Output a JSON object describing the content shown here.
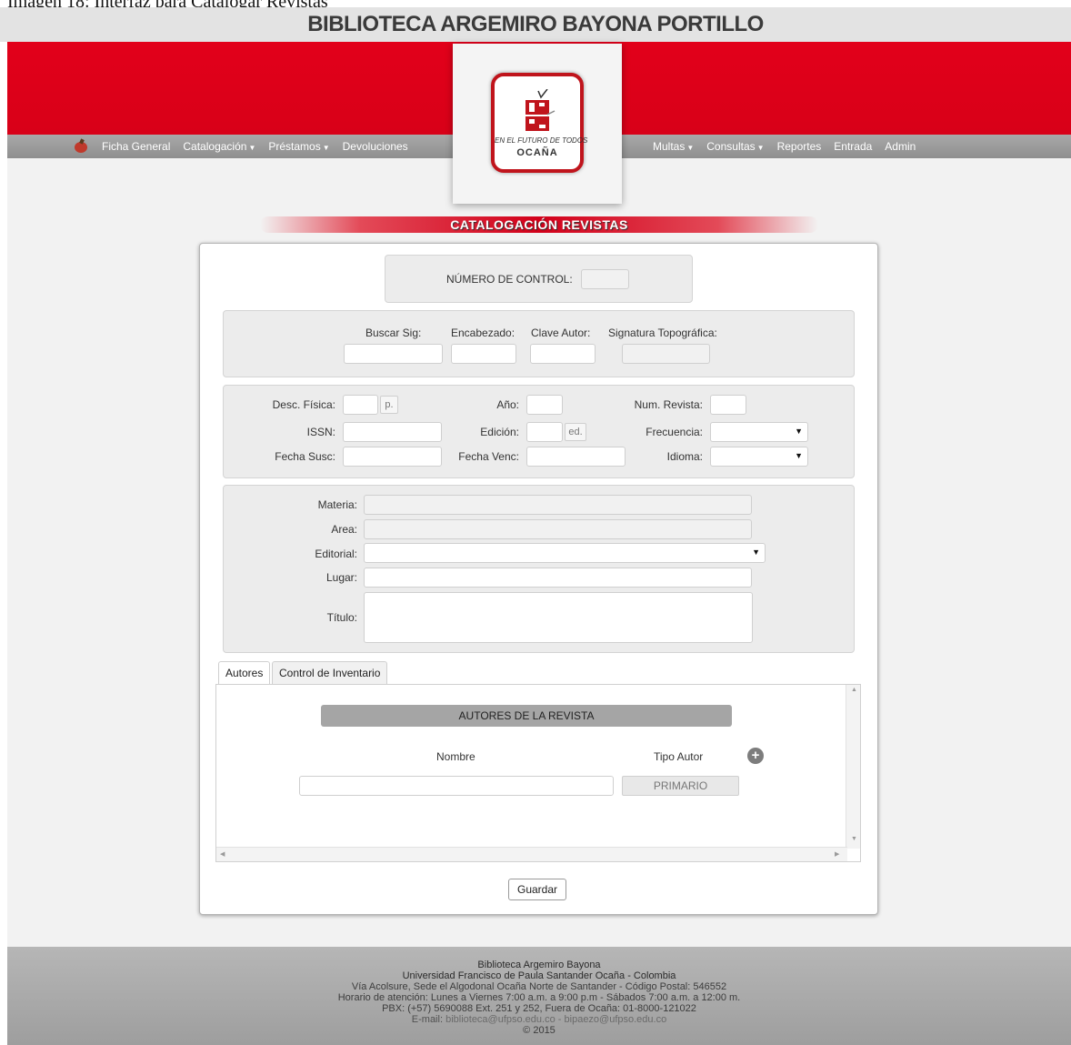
{
  "caption": "Imagen 18: Interfaz para Catalogar Revistas",
  "header": {
    "title": "BIBLIOTECA ARGEMIRO BAYONA PORTILLO"
  },
  "nav": {
    "left": [
      {
        "label": "Ficha General",
        "caret": false
      },
      {
        "label": "Catalogación",
        "caret": true
      },
      {
        "label": "Préstamos",
        "caret": true
      },
      {
        "label": "Devoluciones",
        "caret": false
      }
    ],
    "right": [
      {
        "label": "Multas",
        "caret": true
      },
      {
        "label": "Consultas",
        "caret": true
      },
      {
        "label": "Reportes",
        "caret": false
      },
      {
        "label": "Entrada",
        "caret": false
      },
      {
        "label": "Admin",
        "caret": false
      }
    ]
  },
  "logo": {
    "slogan": "EN EL FUTURO DE TODOS",
    "city": "OCAÑA",
    "mark": "UFPS"
  },
  "page": {
    "section_title": "CATALOGACIÓN REVISTAS"
  },
  "control": {
    "label": "NÚMERO DE CONTROL:",
    "value": ""
  },
  "search": {
    "buscar_sig": "Buscar Sig:",
    "encabezado": "Encabezado:",
    "clave_autor": "Clave Autor:",
    "signatura": "Signatura Topográfica:"
  },
  "details": {
    "desc_fisica": "Desc. Física:",
    "desc_fisica_unit": "p.",
    "anio": "Año:",
    "num_revista": "Num. Revista:",
    "issn": "ISSN:",
    "edicion": "Edición:",
    "edicion_unit": "ed.",
    "frecuencia": "Frecuencia:",
    "fecha_susc": "Fecha Susc:",
    "fecha_venc": "Fecha Venc:",
    "idioma": "Idioma:"
  },
  "subject": {
    "materia": "Materia:",
    "area": "Area:",
    "editorial": "Editorial:",
    "lugar": "Lugar:",
    "titulo": "Título:"
  },
  "tabs": [
    {
      "label": "Autores"
    },
    {
      "label": "Control de Inventario"
    }
  ],
  "authors": {
    "header": "AUTORES DE LA REVISTA",
    "col_nombre": "Nombre",
    "col_tipo": "Tipo Autor",
    "tipo_value": "PRIMARIO"
  },
  "actions": {
    "save": "Guardar"
  },
  "footer": {
    "line1": "Biblioteca Argemiro Bayona",
    "line2": "Universidad Francisco de Paula Santander Ocaña - Colombia",
    "line3": "Vía Acolsure, Sede el Algodonal Ocaña Norte de Santander - Código Postal: 546552",
    "line4": "Horario de atención: Lunes a Viernes 7:00 a.m. a 9:00 p.m - Sábados 7:00 a.m. a 12:00 m.",
    "line5": "PBX: (+57) 5690088 Ext. 251 y 252, Fuera de Ocaña: 01-8000-121022",
    "email_label": "E-mail:",
    "email1": "biblioteca@ufpso.edu.co",
    "email_sep": "-",
    "email2": "bipaezo@ufpso.edu.co",
    "copyright": "© 2015"
  }
}
